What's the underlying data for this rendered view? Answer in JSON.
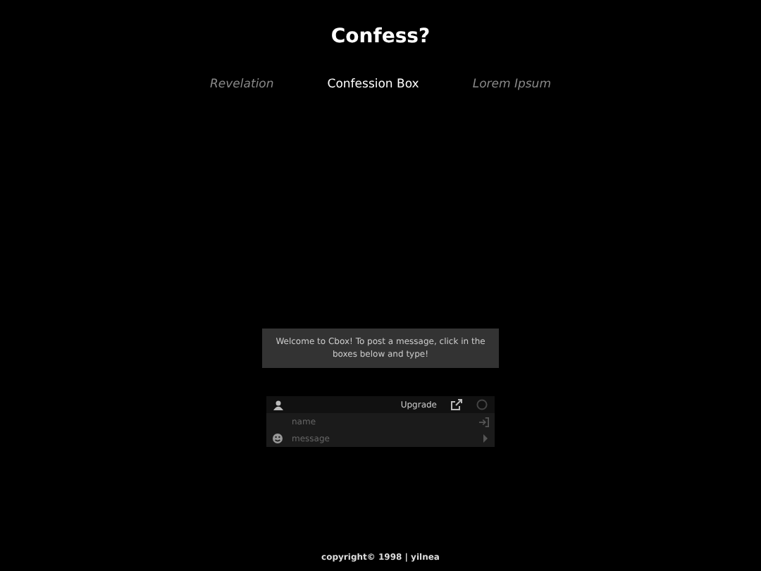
{
  "title": "Confess?",
  "tabs": [
    {
      "label": "Revelation",
      "selected": false
    },
    {
      "label": "Confession Box",
      "selected": true
    },
    {
      "label": "Lorem Ipsum",
      "selected": false
    }
  ],
  "chat": {
    "welcome": "Welcome to Cbox! To post a message, click in the boxes below and type!",
    "upgrade": "Upgrade",
    "name_placeholder": "name",
    "message_placeholder": "message"
  },
  "footer": "copyright© 1998 | yilnea"
}
